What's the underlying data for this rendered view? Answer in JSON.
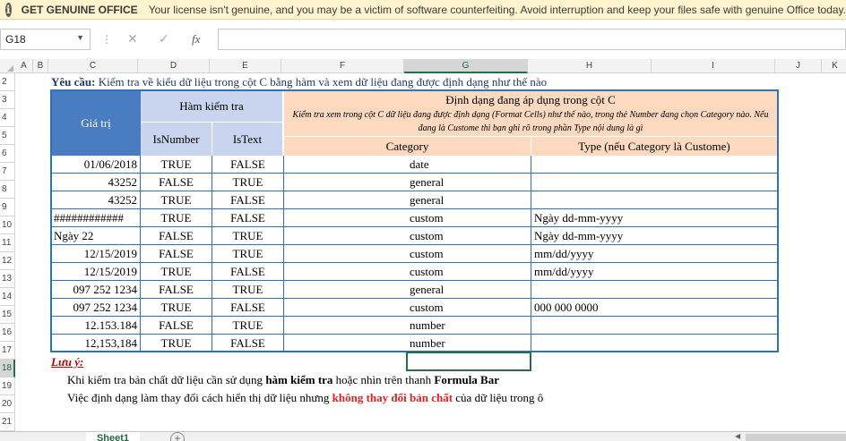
{
  "message_bar": {
    "title": "GET GENUINE OFFICE",
    "text": "Your license isn't genuine, and you may be a victim of software counterfeiting. Avoid interruption and keep your files safe with genuine Office today."
  },
  "formula_bar": {
    "name_box": "G18",
    "fx_label": "fx",
    "formula": ""
  },
  "columns": [
    "A",
    "B",
    "C",
    "D",
    "E",
    "F",
    "G",
    "H",
    "I",
    "J",
    "K"
  ],
  "selected_column": "G",
  "rows": [
    "2",
    "3",
    "4",
    "5",
    "6",
    "7",
    "8",
    "9",
    "10",
    "11",
    "12",
    "13",
    "14",
    "15",
    "16",
    "17",
    "18",
    "19",
    "20",
    "21"
  ],
  "selected_row": "18",
  "requirement": {
    "label": "Yêu cầu:",
    "text": "Kiểm tra về kiểu dữ liệu trong cột C bằng hàm và xem dữ liệu đang được định dạng như thế nào"
  },
  "table": {
    "header_value": "Giá trị",
    "header_check": "Hàm kiểm tra",
    "header_isnumber": "IsNumber",
    "header_istext": "IsText",
    "header_format": "Định dạng đang áp dụng trong cột C",
    "header_format_note": "Kiểm tra xem trong cột C dữ liệu đang được định dạng (Format Cells) như thế nào, trong thẻ Number đang chọn Category nào. Nếu đang là Custome thì bạn ghi rõ trong phần Type nội dung là gì",
    "header_category": "Category",
    "header_type": "Type (nếu Category là Custome)",
    "rows": [
      {
        "value": "01/06/2018",
        "align": "right",
        "isnumber": "TRUE",
        "istext": "FALSE",
        "category": "date",
        "type": ""
      },
      {
        "value": "43252",
        "align": "right",
        "isnumber": "FALSE",
        "istext": "TRUE",
        "category": "general",
        "type": ""
      },
      {
        "value": "43252",
        "align": "right",
        "isnumber": "TRUE",
        "istext": "FALSE",
        "category": "general",
        "type": ""
      },
      {
        "value": "############",
        "align": "left",
        "isnumber": "TRUE",
        "istext": "FALSE",
        "category": "custom",
        "type": "Ngày dd-mm-yyyy"
      },
      {
        "value": "Ngày 22",
        "align": "left",
        "isnumber": "FALSE",
        "istext": "TRUE",
        "category": "custom",
        "type": "Ngày dd-mm-yyyy"
      },
      {
        "value": "12/15/2019",
        "align": "right",
        "isnumber": "FALSE",
        "istext": "TRUE",
        "category": "custom",
        "type": "mm/dd/yyyy"
      },
      {
        "value": "12/15/2019",
        "align": "right",
        "isnumber": "TRUE",
        "istext": "FALSE",
        "category": "custom",
        "type": "mm/dd/yyyy"
      },
      {
        "value": "097 252 1234",
        "align": "right",
        "isnumber": "FALSE",
        "istext": "TRUE",
        "category": "general",
        "type": ""
      },
      {
        "value": "097 252 1234",
        "align": "right",
        "isnumber": "TRUE",
        "istext": "FALSE",
        "category": "custom",
        "type": "000 000 0000"
      },
      {
        "value": "12.153.184",
        "align": "right",
        "isnumber": "FALSE",
        "istext": "TRUE",
        "category": "number",
        "type": ""
      },
      {
        "value": "12,153,184",
        "align": "right",
        "isnumber": "TRUE",
        "istext": "FALSE",
        "category": "number",
        "type": ""
      }
    ]
  },
  "notes": {
    "title": "Lưu ý:",
    "line1_a": "Khi kiểm tra bản chất dữ liệu cần sử dụng ",
    "line1_b": "hàm kiểm tra",
    "line1_c": " hoặc nhìn trên thanh ",
    "line1_d": "Formula Bar",
    "line2_a": "Việc định dạng làm thay đổi cách hiển thị dữ liệu nhưng ",
    "line2_b": "không thay đổi bản chất",
    "line2_c": " của dữ liệu trong ô"
  },
  "sheet_tab": "Sheet1",
  "add_sheet_symbol": "+"
}
